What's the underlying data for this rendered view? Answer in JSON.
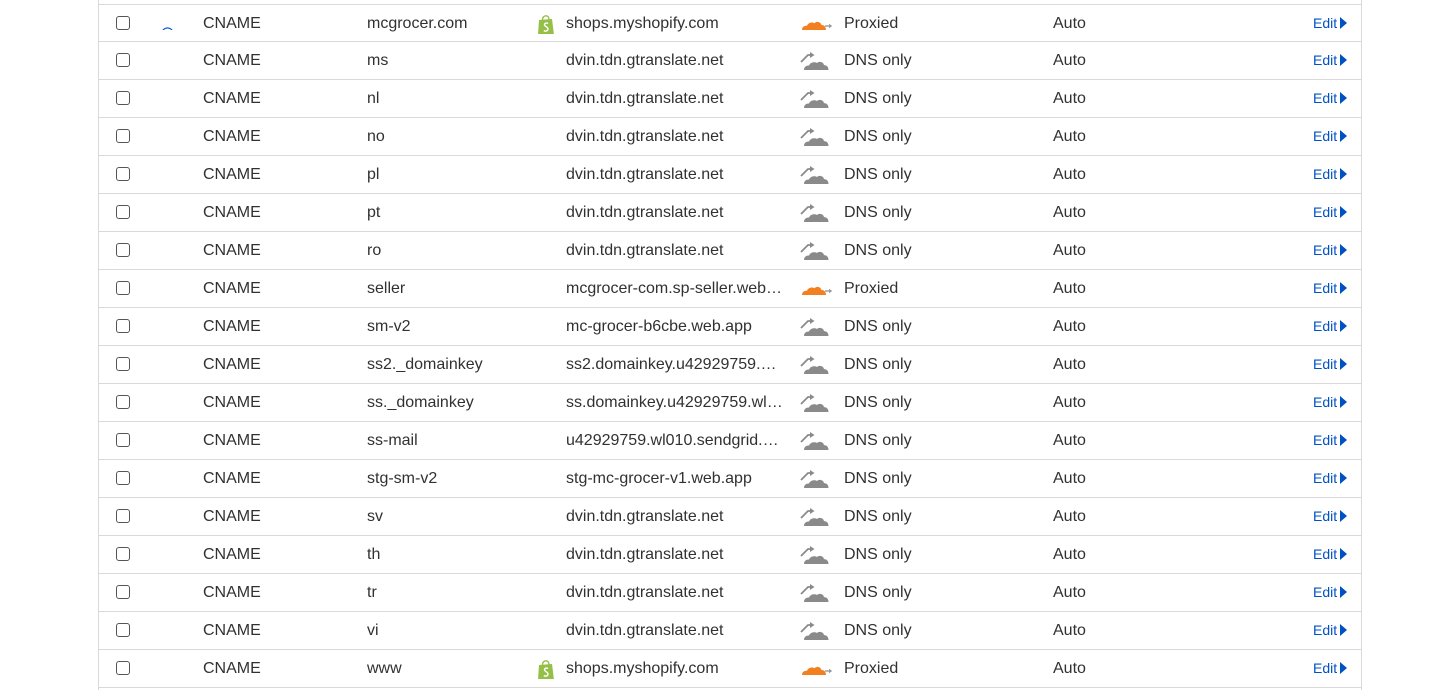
{
  "colors": {
    "link": "#0051c3",
    "proxied_cloud": "#f38020",
    "dns_only_cloud": "#8a8a8a",
    "border": "#d9d9d9",
    "shopify": "#95bf47"
  },
  "edit_label": "Edit",
  "rows": [
    {
      "type": "CNAME",
      "name": "mcgrocer.com",
      "content": "shops.myshopify.com",
      "proxy_status": "Proxied",
      "ttl": "Auto",
      "info_icon": true,
      "shopify_icon": true
    },
    {
      "type": "CNAME",
      "name": "ms",
      "content": "dvin.tdn.gtranslate.net",
      "proxy_status": "DNS only",
      "ttl": "Auto",
      "info_icon": false,
      "shopify_icon": false
    },
    {
      "type": "CNAME",
      "name": "nl",
      "content": "dvin.tdn.gtranslate.net",
      "proxy_status": "DNS only",
      "ttl": "Auto",
      "info_icon": false,
      "shopify_icon": false
    },
    {
      "type": "CNAME",
      "name": "no",
      "content": "dvin.tdn.gtranslate.net",
      "proxy_status": "DNS only",
      "ttl": "Auto",
      "info_icon": false,
      "shopify_icon": false
    },
    {
      "type": "CNAME",
      "name": "pl",
      "content": "dvin.tdn.gtranslate.net",
      "proxy_status": "DNS only",
      "ttl": "Auto",
      "info_icon": false,
      "shopify_icon": false
    },
    {
      "type": "CNAME",
      "name": "pt",
      "content": "dvin.tdn.gtranslate.net",
      "proxy_status": "DNS only",
      "ttl": "Auto",
      "info_icon": false,
      "shopify_icon": false
    },
    {
      "type": "CNAME",
      "name": "ro",
      "content": "dvin.tdn.gtranslate.net",
      "proxy_status": "DNS only",
      "ttl": "Auto",
      "info_icon": false,
      "shopify_icon": false
    },
    {
      "type": "CNAME",
      "name": "seller",
      "content": "mcgrocer-com.sp-seller.web…",
      "proxy_status": "Proxied",
      "ttl": "Auto",
      "info_icon": false,
      "shopify_icon": false
    },
    {
      "type": "CNAME",
      "name": "sm-v2",
      "content": "mc-grocer-b6cbe.web.app",
      "proxy_status": "DNS only",
      "ttl": "Auto",
      "info_icon": false,
      "shopify_icon": false
    },
    {
      "type": "CNAME",
      "name": "ss2._domainkey",
      "content": "ss2.domainkey.u42929759.w…",
      "proxy_status": "DNS only",
      "ttl": "Auto",
      "info_icon": false,
      "shopify_icon": false
    },
    {
      "type": "CNAME",
      "name": "ss._domainkey",
      "content": "ss.domainkey.u42929759.wl…",
      "proxy_status": "DNS only",
      "ttl": "Auto",
      "info_icon": false,
      "shopify_icon": false
    },
    {
      "type": "CNAME",
      "name": "ss-mail",
      "content": "u42929759.wl010.sendgrid.net",
      "proxy_status": "DNS only",
      "ttl": "Auto",
      "info_icon": false,
      "shopify_icon": false
    },
    {
      "type": "CNAME",
      "name": "stg-sm-v2",
      "content": "stg-mc-grocer-v1.web.app",
      "proxy_status": "DNS only",
      "ttl": "Auto",
      "info_icon": false,
      "shopify_icon": false
    },
    {
      "type": "CNAME",
      "name": "sv",
      "content": "dvin.tdn.gtranslate.net",
      "proxy_status": "DNS only",
      "ttl": "Auto",
      "info_icon": false,
      "shopify_icon": false
    },
    {
      "type": "CNAME",
      "name": "th",
      "content": "dvin.tdn.gtranslate.net",
      "proxy_status": "DNS only",
      "ttl": "Auto",
      "info_icon": false,
      "shopify_icon": false
    },
    {
      "type": "CNAME",
      "name": "tr",
      "content": "dvin.tdn.gtranslate.net",
      "proxy_status": "DNS only",
      "ttl": "Auto",
      "info_icon": false,
      "shopify_icon": false
    },
    {
      "type": "CNAME",
      "name": "vi",
      "content": "dvin.tdn.gtranslate.net",
      "proxy_status": "DNS only",
      "ttl": "Auto",
      "info_icon": false,
      "shopify_icon": false
    },
    {
      "type": "CNAME",
      "name": "www",
      "content": "shops.myshopify.com",
      "proxy_status": "Proxied",
      "ttl": "Auto",
      "info_icon": false,
      "shopify_icon": true
    }
  ]
}
